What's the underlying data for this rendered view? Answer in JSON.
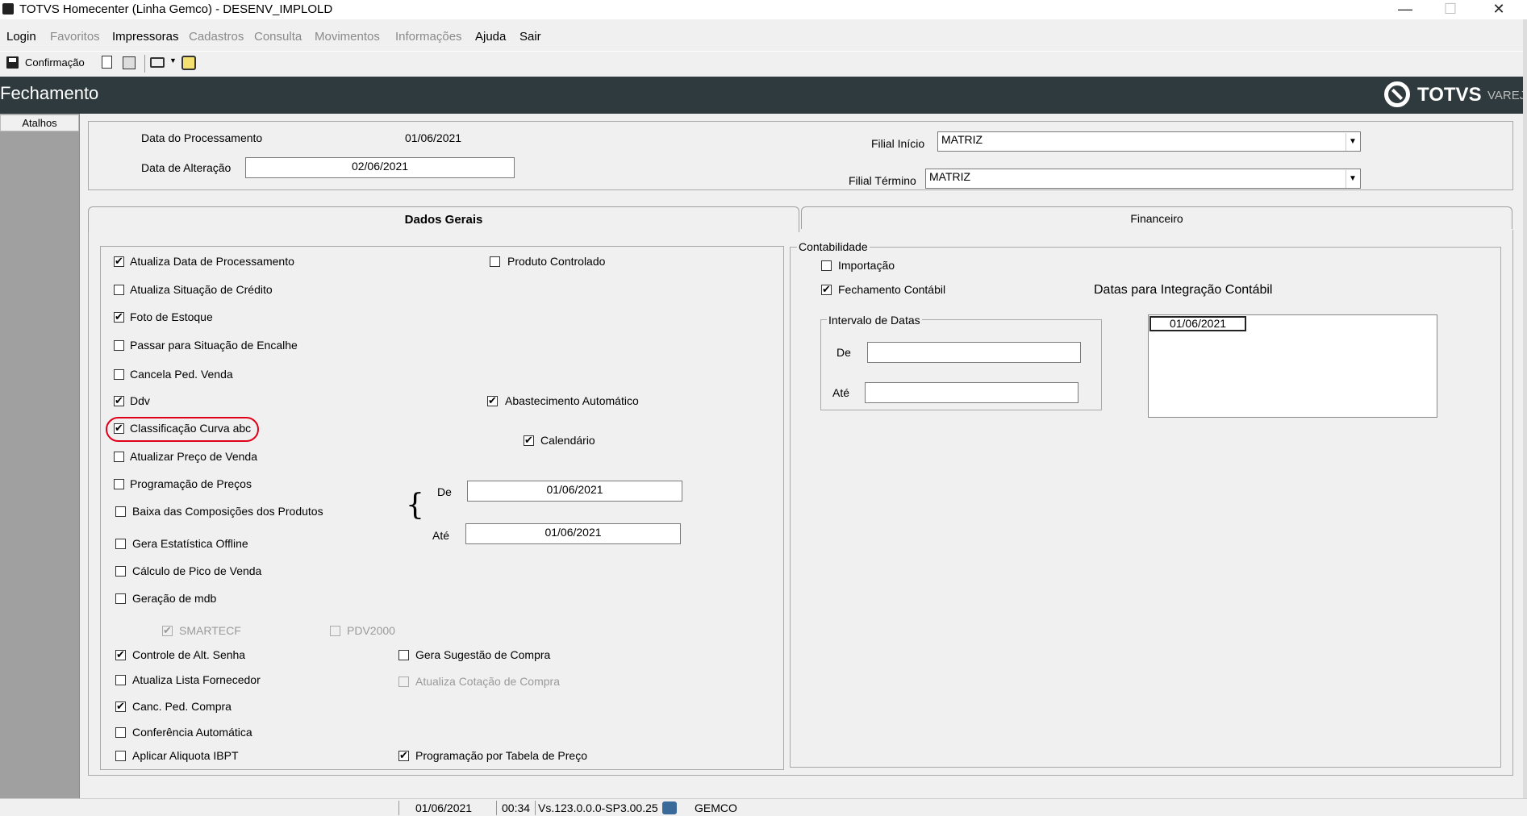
{
  "window": {
    "title": "TOTVS Homecenter (Linha Gemco) - DESENV_IMPLOLD",
    "minimize": "—",
    "maximize": "☐",
    "close": "✕"
  },
  "menu": [
    {
      "label": "Login",
      "enabled": true
    },
    {
      "label": "Favoritos",
      "enabled": false
    },
    {
      "label": "Impressoras",
      "enabled": true
    },
    {
      "label": "Cadastros",
      "enabled": false
    },
    {
      "label": "Consulta",
      "enabled": false
    },
    {
      "label": "Movimentos",
      "enabled": false
    },
    {
      "label": "Informações",
      "enabled": false
    },
    {
      "label": "Ajuda",
      "enabled": true
    },
    {
      "label": "Sair",
      "enabled": true
    }
  ],
  "toolbar": {
    "confirm_label": "Confirmação"
  },
  "header": {
    "title": "Fechamento",
    "logo": "TOTVS",
    "logo_sub": "VAREJO"
  },
  "sidebar": {
    "atalhos": "Atalhos"
  },
  "top": {
    "data_proc_label": "Data do Processamento",
    "data_proc_value": "01/06/2021",
    "data_alt_label": "Data de Alteração",
    "data_alt_value": "02/06/2021",
    "filial_inicio_label": "Filial Início",
    "filial_inicio_value": "MATRIZ",
    "filial_termino_label": "Filial Término",
    "filial_termino_value": "MATRIZ"
  },
  "tabs": {
    "dados_gerais": "Dados Gerais",
    "financeiro": "Financeiro"
  },
  "checks": {
    "atualiza_data": "Atualiza Data de Processamento",
    "atualiza_situacao": "Atualiza Situação de Crédito",
    "foto_estoque": "Foto de Estoque",
    "passar_encalhe": "Passar para Situação de Encalhe",
    "cancela_ped_venda": "Cancela Ped. Venda",
    "ddv": "Ddv",
    "classificacao": "Classificação Curva abc",
    "atualizar_preco": "Atualizar Preço de Venda",
    "programacao_precos": "Programação de Preços",
    "baixa_composicoes": "Baixa das Composições dos Produtos",
    "gera_estatistica": "Gera Estatística Offline",
    "calculo_pico": "Cálculo de Pico de Venda",
    "geracao_mdb": "Geração de mdb",
    "smartecf": "SMARTECF",
    "pdv2000": "PDV2000",
    "controle_senha": "Controle de Alt. Senha",
    "atualiza_fornecedor": "Atualiza Lista Fornecedor",
    "canc_ped_compra": "Canc. Ped. Compra",
    "conferencia": "Conferência Automática",
    "aplicar_ibpt": "Aplicar Aliquota IBPT",
    "produto_controlado": "Produto Controlado",
    "abastecimento": "Abastecimento Automático",
    "calendario": "Calendário",
    "gera_sugestao": "Gera Sugestão de Compra",
    "atualiza_cotacao": "Atualiza Cotação de Compra",
    "programacao_tabela": "Programação por Tabela de Preço"
  },
  "range": {
    "de_label": "De",
    "de_value": "01/06/2021",
    "ate_label": "Até",
    "ate_value": "01/06/2021",
    "brace": "{"
  },
  "contab": {
    "group": "Contabilidade",
    "importacao": "Importação",
    "fechamento": "Fechamento Contábil",
    "datas_integracao": "Datas para Integração Contábil",
    "intervalo": "Intervalo de Datas",
    "de_label": "De",
    "ate_label": "Até",
    "list_item": "01/06/2021"
  },
  "status": {
    "date": "01/06/2021",
    "time": "00:34",
    "version": "Vs.123.0.0.0-SP3.00.25",
    "user": "GEMCO"
  },
  "colors": {
    "header_bg": "#2e3a3d",
    "highlight": "#e0001a"
  }
}
